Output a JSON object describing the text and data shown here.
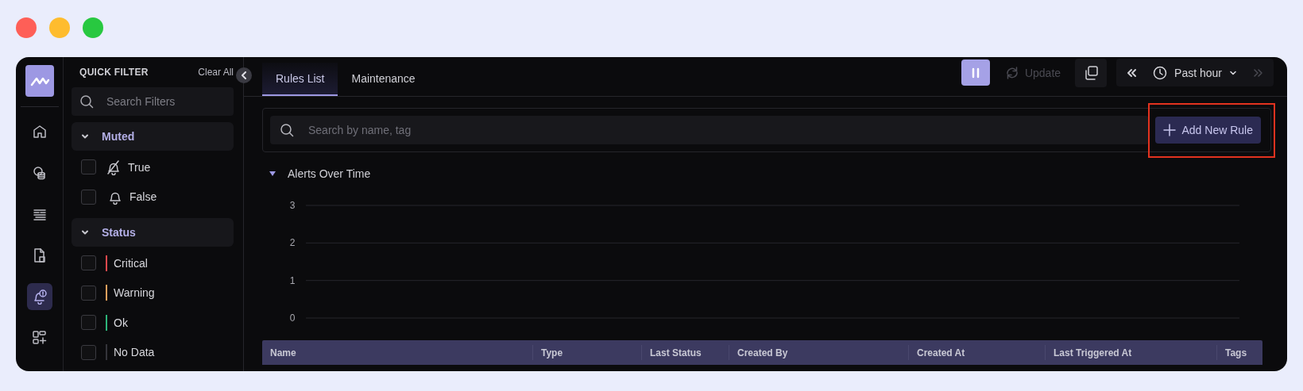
{
  "nav": [
    {
      "selected": false
    },
    {
      "selected": false
    },
    {
      "selected": false
    },
    {
      "selected": false
    },
    {
      "selected": true
    },
    {
      "selected": false
    }
  ],
  "quick_filter": {
    "title": "QUICK FILTER",
    "clear": "Clear All",
    "search": {
      "placeholder": "Search Filters"
    },
    "sections": [
      {
        "title": "Muted",
        "expanded": true,
        "options": [
          {
            "kind": "muted",
            "label": "True",
            "checked": false
          },
          {
            "kind": "unmuted",
            "label": "False",
            "checked": false
          }
        ]
      },
      {
        "title": "Status",
        "expanded": true,
        "options": [
          {
            "kind": "status",
            "label": "Critical",
            "checked": false,
            "color": "#e5484d"
          },
          {
            "kind": "status",
            "label": "Warning",
            "checked": false,
            "color": "#e9a05c"
          },
          {
            "kind": "status",
            "label": "Ok",
            "checked": false,
            "color": "#2db47a"
          },
          {
            "kind": "status",
            "label": "No Data",
            "checked": false,
            "color": "#34343a"
          }
        ]
      }
    ]
  },
  "tabs": [
    {
      "label": "Rules List",
      "selected": true
    },
    {
      "label": "Maintenance",
      "selected": false
    }
  ],
  "toolbar": {
    "paused": true,
    "update": {
      "label": "Update",
      "disabled": true
    },
    "time_range": {
      "label": "Past hour",
      "next_disabled": true
    }
  },
  "search": {
    "placeholder": "Search by name, tag"
  },
  "add_button": {
    "label": "Add New Rule",
    "highlighted": true
  },
  "chart": {
    "title": "Alerts Over Time",
    "expanded": true,
    "y_axis_labels": [
      "3",
      "2",
      "1",
      "0"
    ]
  },
  "table": {
    "columns": [
      "Name",
      "Type",
      "Last Status",
      "Created By",
      "Created At",
      "Last Triggered At",
      "Tags"
    ]
  }
}
